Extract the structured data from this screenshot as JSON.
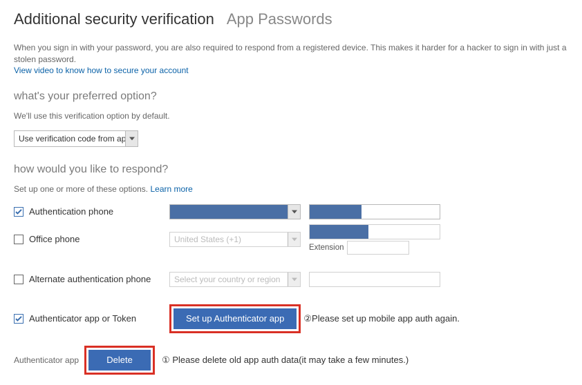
{
  "header": {
    "title": "Additional security verification",
    "subtitle": "App Passwords"
  },
  "intro": {
    "text": "When you sign in with your password, you are also required to respond from a registered device. This makes it harder for a hacker to sign in with just a stolen password.",
    "link": "View video to know how to secure your account"
  },
  "preferred": {
    "heading": "what's your preferred option?",
    "sub": "We'll use this verification option by default.",
    "selected": "Use verification code from app or token"
  },
  "respond": {
    "heading": "how would you like to respond?",
    "sub": "Set up one or more of these options.",
    "learn_more": "Learn more"
  },
  "rows": {
    "auth_phone": {
      "label": "Authentication phone",
      "checked": true
    },
    "office_phone": {
      "label": "Office phone",
      "dropdown_text": "United States (+1)",
      "extension_label": "Extension"
    },
    "alt_phone": {
      "label": "Alternate authentication phone",
      "dropdown_text": "Select your country or region"
    },
    "auth_app": {
      "label": "Authenticator app or Token",
      "checked": true,
      "button": "Set up Authenticator app"
    }
  },
  "delete": {
    "label": "Authenticator app",
    "button": "Delete"
  },
  "annotations": {
    "setup": "②Please set up mobile app auth again.",
    "delete": "① Please delete old app auth data(it may take a few minutes.)"
  }
}
